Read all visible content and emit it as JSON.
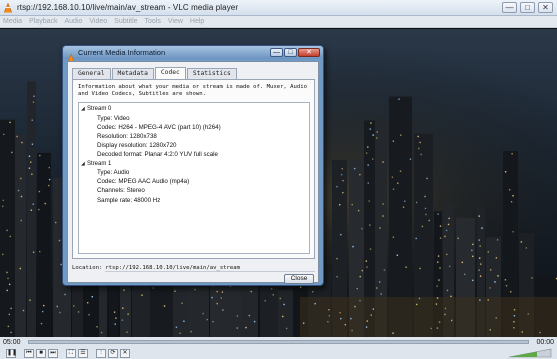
{
  "window": {
    "title": "rtsp://192.168.10.10/live/main/av_stream - VLC media player",
    "controls": {
      "minimize": "—",
      "maximize": "□",
      "close": "✕"
    }
  },
  "menubar": {
    "items": [
      "Media",
      "Playback",
      "Audio",
      "Video",
      "Subtitle",
      "Tools",
      "View",
      "Help"
    ]
  },
  "playback": {
    "time_elapsed": "05:00",
    "time_total": "00:00",
    "buttons": [
      {
        "name": "pause-button",
        "icon": "pause-icon",
        "glyph": "❚❚"
      },
      {
        "name": "previous-button",
        "icon": "previous-icon",
        "glyph": "⏮"
      },
      {
        "name": "stop-button",
        "icon": "stop-icon",
        "glyph": "■"
      },
      {
        "name": "next-button",
        "icon": "next-icon",
        "glyph": "⏭"
      },
      {
        "name": "fullscreen-button",
        "icon": "fullscreen-icon",
        "glyph": "⛶"
      },
      {
        "name": "playlist-button",
        "icon": "playlist-icon",
        "glyph": "☰"
      },
      {
        "name": "extended-settings-button",
        "icon": "equalizer-icon",
        "glyph": "⫶"
      },
      {
        "name": "loop-button",
        "icon": "loop-icon",
        "glyph": "⟳"
      },
      {
        "name": "shuffle-button",
        "icon": "shuffle-icon",
        "glyph": "✕"
      }
    ]
  },
  "dialog": {
    "title": "Current Media Information",
    "tabs": [
      "General",
      "Metadata",
      "Codec",
      "Statistics"
    ],
    "active_tab": "Codec",
    "info_text": "Information about what your media or stream is made of. Muxer, Audio and Video Codecs, Subtitles are shown.",
    "streams": [
      {
        "name": "Stream 0",
        "properties": [
          "Type: Video",
          "Codec: H264 - MPEG-4 AVC (part 10) (h264)",
          "Resolution: 1280x738",
          "Display resolution: 1280x720",
          "Decoded format: Planar 4:2:0 YUV full scale"
        ]
      },
      {
        "name": "Stream 1",
        "properties": [
          "Type: Audio",
          "Codec: MPEG AAC Audio (mp4a)",
          "Channels: Stereo",
          "Sample rate: 48000 Hz"
        ]
      }
    ],
    "location_label": "Location:",
    "location_value": "rtsp://192.168.10.10/live/main/av_stream",
    "close_label": "Close"
  }
}
